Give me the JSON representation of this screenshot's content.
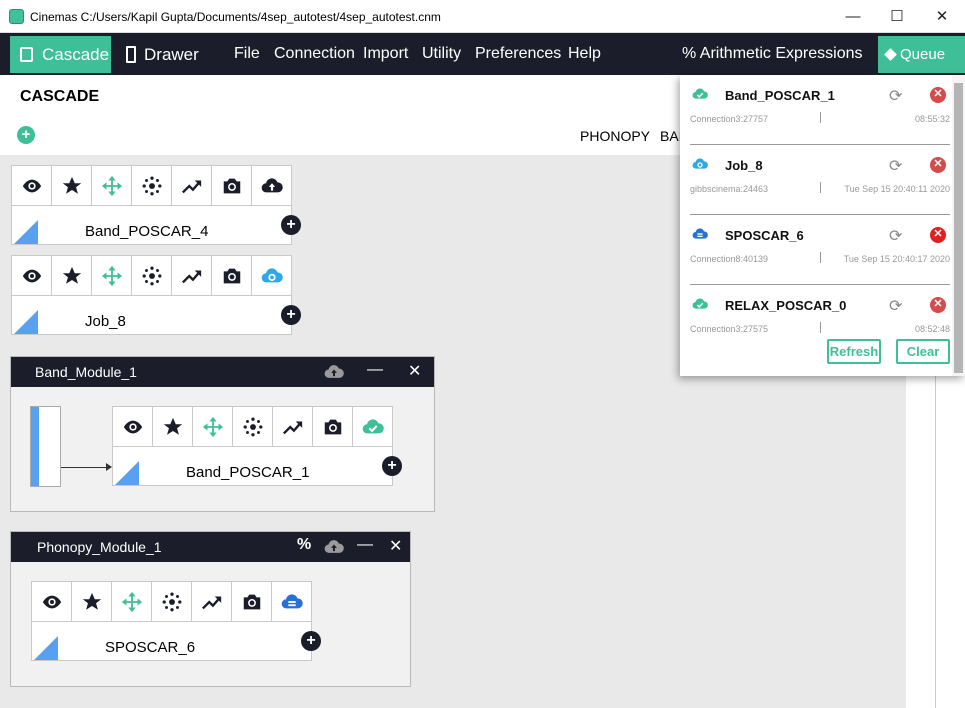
{
  "window": {
    "title": "Cinemas C:/Users/Kapil Gupta/Documents/4sep_autotest/4sep_autotest.cnm",
    "minimize": "—",
    "maximize": "☐",
    "close": "✕"
  },
  "menubar": {
    "cascade": "Cascade",
    "drawer": "Drawer",
    "items": [
      "File",
      "Connection",
      "Import",
      "Utility",
      "Preferences",
      "Help"
    ],
    "arith": "% Arithmetic Expressions",
    "queue": "Queue"
  },
  "header": {
    "title": "CASCADE",
    "add": "+",
    "tabs": [
      "PHONOPY",
      "BAI"
    ]
  },
  "cards": [
    {
      "name": "Band_POSCAR_4",
      "status_icon": "cloud-upload-icon"
    },
    {
      "name": "Job_8",
      "status_icon": "cloud-gear-icon"
    }
  ],
  "modules": [
    {
      "title": "Band_Module_1",
      "card": {
        "name": "Band_POSCAR_1",
        "status_icon": "cloud-check-icon"
      }
    },
    {
      "title": "Phonopy_Module_1",
      "card": {
        "name": "SPOSCAR_6",
        "status_icon": "cloud-server-icon"
      }
    }
  ],
  "queue": {
    "items": [
      {
        "name": "Band_POSCAR_1",
        "connection": "Connection3:27757",
        "time": "08:55:32",
        "status": "done",
        "delete_color": "#d54a4a"
      },
      {
        "name": "Job_8",
        "connection": "gibbscinema:24463",
        "time": "Tue Sep 15 20:40:11 2020",
        "status": "running",
        "delete_color": "#d54a4a"
      },
      {
        "name": "SPOSCAR_6",
        "connection": "Connection8:40139",
        "time": "Tue Sep 15 20:40:17 2020",
        "status": "queued",
        "delete_color": "#e02020"
      },
      {
        "name": "RELAX_POSCAR_0",
        "connection": "Connection3:27575",
        "time": "08:52:48",
        "status": "done",
        "delete_color": "#d54a4a"
      }
    ],
    "refresh": "Refresh",
    "clear": "Clear"
  },
  "colors": {
    "accent": "#3fbf98",
    "dark": "#1b1e2a",
    "blue": "#5aa0f0"
  }
}
